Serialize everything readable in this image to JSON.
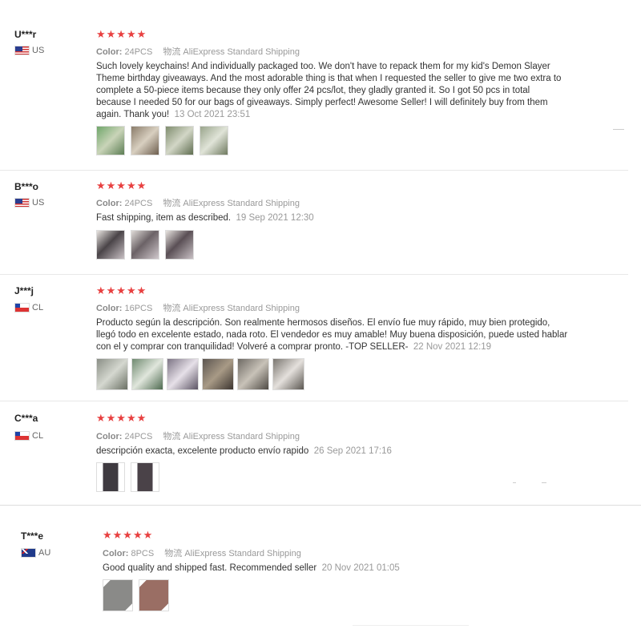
{
  "reviews": [
    {
      "user": "U***r",
      "country": "US",
      "flag": "us",
      "stars": "★★★★★",
      "color_label": "Color:",
      "color_value": "24PCS",
      "shipping": "物流 AliExpress Standard Shipping",
      "text": "Such lovely keychains! And individually packaged too. We don't have to repack them for my kid's Demon Slayer Theme birthday giveaways. And the most adorable thing is that when I requested the seller to give me two extra to complete a 50-piece items because they only offer 24 pcs/lot, they gladly granted it. So I got 50 pcs in total because I needed 50 for our bags of giveaways. Simply perfect! Awesome Seller! I will definitely buy from them again. Thank you!",
      "date": "13 Oct 2021 23:51",
      "thumb_colors": [
        "#6f9a68",
        "#8a7c6a",
        "#7f8d6e",
        "#9aa58c"
      ]
    },
    {
      "user": "B***o",
      "country": "US",
      "flag": "us",
      "stars": "★★★★★",
      "color_label": "Color:",
      "color_value": "24PCS",
      "shipping": "物流 AliExpress Standard Shipping",
      "text": "Fast shipping, item as described.",
      "date": "19 Sep 2021 12:30",
      "thumb_colors": [
        "#4a4448",
        "#6b6266",
        "#5a4f55"
      ]
    },
    {
      "user": "J***j",
      "country": "CL",
      "flag": "cl",
      "stars": "★★★★★",
      "color_label": "Color:",
      "color_value": "16PCS",
      "shipping": "物流 AliExpress Standard Shipping",
      "text": "Producto según la descripción. Son realmente hermosos diseños. El envío fue muy rápido, muy bien protegido, llegó todo en excelente estado, nada roto. El vendedor es muy amable! Muy buena disposición, puede usted hablar con el y comprar con tranquilidad! Volveré a comprar pronto. -TOP SELLER-",
      "date": "22 Nov 2021 12:19",
      "thumb_colors": [
        "#8a8f86",
        "#6f8a70",
        "#7c7484",
        "#5c5550",
        "#6e6a64",
        "#7a7670"
      ]
    },
    {
      "user": "C***a",
      "country": "CL",
      "flag": "cl",
      "stars": "★★★★★",
      "color_label": "Color:",
      "color_value": "24PCS",
      "shipping": "物流 AliExpress Standard Shipping",
      "text": "descripción exacta, excelente producto envío rapido",
      "date": "26 Sep 2021 17:16",
      "thumb_colors": [
        "#3e3a40",
        "#4a4248"
      ]
    },
    {
      "user": "T***e",
      "country": "AU",
      "flag": "au",
      "stars": "★★★★★",
      "color_label": "Color:",
      "color_value": "8PCS",
      "shipping": "物流 AliExpress Standard Shipping",
      "text": "Good quality and shipped fast. Recommended seller",
      "date": "20 Nov 2021 01:05",
      "thumb_colors": [
        "#8a8a88",
        "#9a6e64"
      ]
    }
  ]
}
